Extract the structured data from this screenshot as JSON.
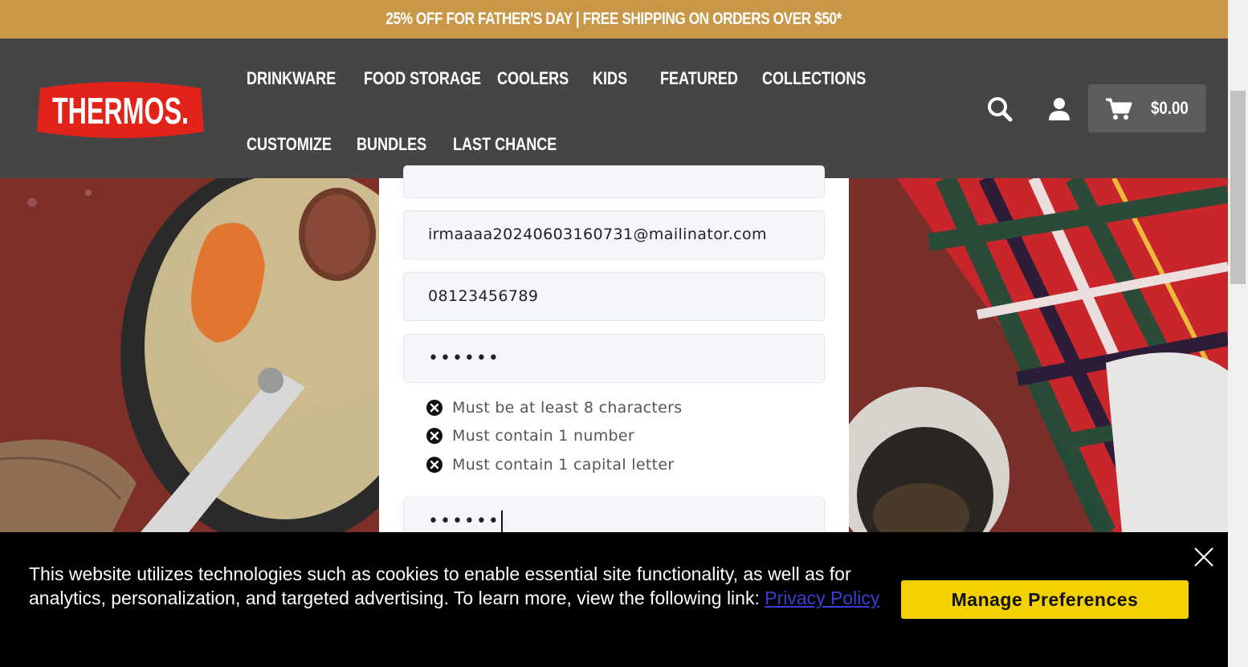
{
  "promo": {
    "text": "25% OFF FOR FATHER'S DAY | FREE SHIPPING ON ORDERS OVER $50*"
  },
  "header": {
    "logo_text": "THERMOS",
    "nav": {
      "drinkware": "DRINKWARE",
      "food_storage": "FOOD STORAGE",
      "coolers": "COOLERS",
      "kids": "KIDS",
      "featured": "FEATURED",
      "collections": "COLLECTIONS",
      "customize": "CUSTOMIZE",
      "bundles": "BUNDLES",
      "last_chance": "LAST CHANCE"
    },
    "icons": {
      "search": "search-icon",
      "account": "user-icon",
      "cart": "cart-icon"
    },
    "cart_total": "$0.00"
  },
  "form": {
    "email_value": "irmaaaa20240603160731@mailinator.com",
    "phone_value": "08123456789",
    "password_masked": "••••••",
    "confirm_password_masked": "••••••",
    "rules": {
      "length": "Must be at least 8 characters",
      "number": "Must contain 1 number",
      "capital": "Must contain 1 capital letter"
    }
  },
  "cookie_banner": {
    "text": "This website utilizes technologies such as cookies to enable essential site functionality, as well as for analytics, personalization, and targeted advertising. To learn more, view the following link: ",
    "link_label": "Privacy Policy",
    "button_label": "Manage Preferences"
  },
  "colors": {
    "promo_bg": "#c89748",
    "header_bg": "#454545",
    "logo_red": "#e2231a",
    "button_yellow": "#f3d000"
  }
}
